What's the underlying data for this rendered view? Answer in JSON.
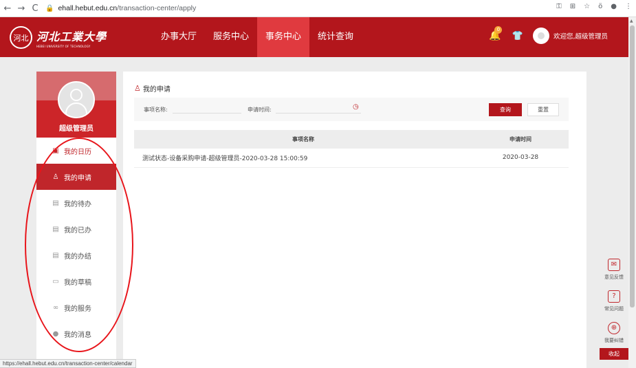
{
  "browser": {
    "back": "←",
    "forward": "→",
    "reload": "C",
    "url_host": "ehall.hebut.edu.cn",
    "url_path": "/transaction-center/apply"
  },
  "header": {
    "logo_seal": "河北",
    "logo_cn": "河北工業大學",
    "logo_en": "HEBEI UNIVERSITY OF TECHNOLOGY",
    "nav": [
      {
        "label": "办事大厅"
      },
      {
        "label": "服务中心"
      },
      {
        "label": "事务中心"
      },
      {
        "label": "统计查询"
      }
    ],
    "active_nav": "事务中心",
    "notification_count": "0",
    "welcome_text": "欢迎您,超级管理员"
  },
  "sidebar": {
    "user_name": "超级管理员",
    "items": [
      {
        "label": "我的日历",
        "icon": "calendar-icon"
      },
      {
        "label": "我的申请",
        "icon": "user-apply-icon"
      },
      {
        "label": "我的待办",
        "icon": "todo-icon"
      },
      {
        "label": "我的已办",
        "icon": "done-icon"
      },
      {
        "label": "我的办结",
        "icon": "finished-icon"
      },
      {
        "label": "我的草稿",
        "icon": "draft-icon"
      },
      {
        "label": "我的服务",
        "icon": "link-icon"
      },
      {
        "label": "我的消息",
        "icon": "bell-icon"
      }
    ],
    "active_item": "我的申请"
  },
  "panel": {
    "title": "我的申请",
    "filter": {
      "name_label": "事项名称:",
      "time_label": "申请时间:",
      "query_button": "查询",
      "reset_button": "重置"
    },
    "table": {
      "headers": [
        "事项名称",
        "申请时间"
      ],
      "rows": [
        [
          "测试状态-设备采购申请-超级管理员-2020-03-28 15:00:59",
          "2020-03-28"
        ]
      ]
    }
  },
  "float_toolbar": {
    "items": [
      {
        "label": "意见反馈",
        "icon": "feedback-icon"
      },
      {
        "label": "常见问题",
        "icon": "faq-icon"
      },
      {
        "label": "我要纠错",
        "icon": "correct-icon"
      }
    ],
    "collapse_label": "收起"
  },
  "status_bar": {
    "text": "https://ehall.hebut.edu.cn/transaction-center/calendar"
  },
  "colors": {
    "brand_red": "#b3161c",
    "active_nav": "#e03a3f",
    "annotation": "#e8151b"
  }
}
